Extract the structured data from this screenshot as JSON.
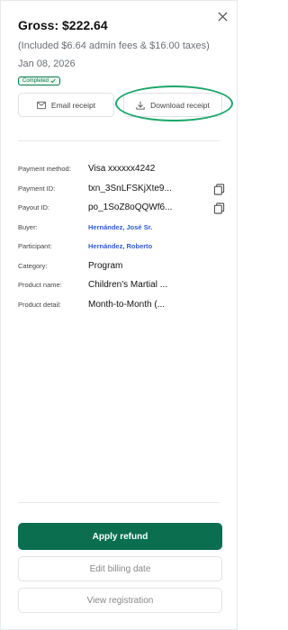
{
  "header": {
    "gross": "Gross: $222.64",
    "included": "(Included $6.64 admin fees & $16.00 taxes)",
    "date": "Jan 08, 2026",
    "status_badge": "Completed"
  },
  "actions": {
    "email_receipt": "Email receipt",
    "download_receipt": "Download receipt"
  },
  "details": [
    {
      "label": "Payment method:",
      "value": "Visa xxxxxx4242"
    },
    {
      "label": "Payment ID:",
      "value": "txn_3SnLFSKjXte9..."
    },
    {
      "label": "Payout ID:",
      "value": "po_1SoZ8oQQWf6..."
    },
    {
      "label": "Buyer:",
      "value": "Hernández, José Sr."
    },
    {
      "label": "Participant:",
      "value": "Hernández, Roberto"
    },
    {
      "label": "Category:",
      "value": "Program"
    },
    {
      "label": "Product name:",
      "value": "Children's Martial ..."
    },
    {
      "label": "Product detail:",
      "value": "Month-to-Month (..."
    }
  ],
  "footer": {
    "apply_refund": "Apply refund",
    "edit_billing_date": "Edit billing date",
    "view_registration": "View registration"
  },
  "colors": {
    "primary": "#0b6e4f",
    "highlight": "#1aa66a",
    "link": "#2d5bd6",
    "badge": "#0b7a4f"
  },
  "icons": {
    "close": "close-icon",
    "mail": "mail-icon",
    "download": "download-icon",
    "copy": "copy-icon",
    "check": "check-icon"
  }
}
